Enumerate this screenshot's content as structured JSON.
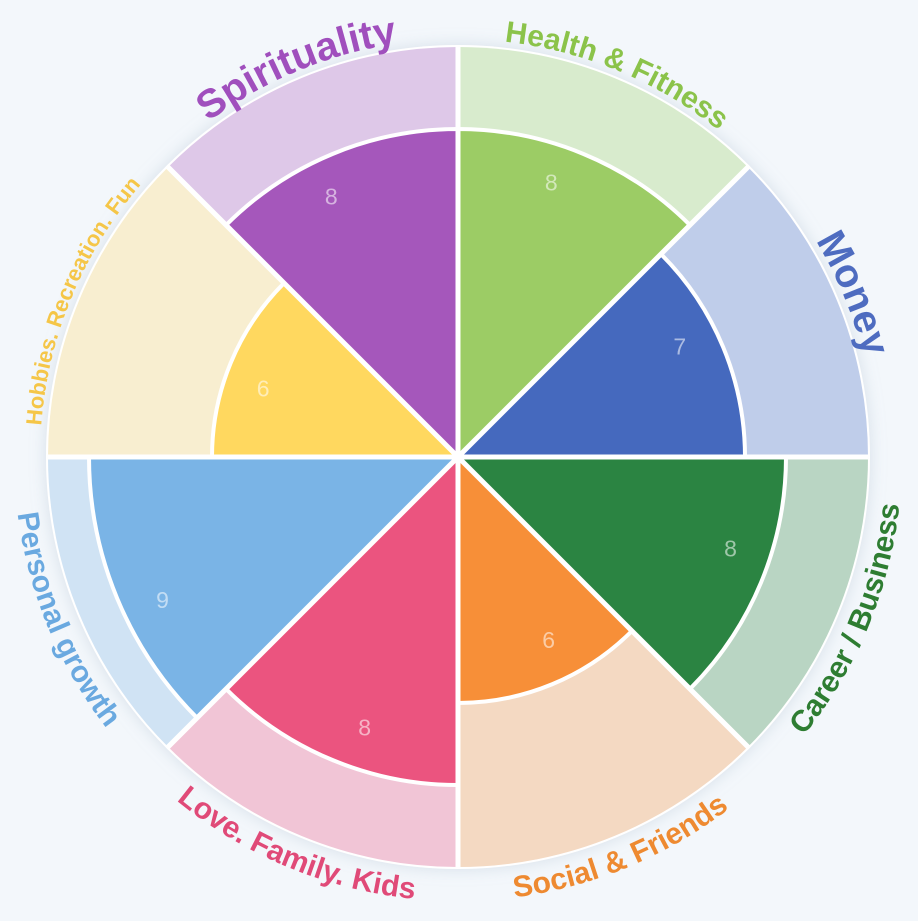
{
  "chart_data": {
    "type": "radial-bar",
    "scale_max": 10,
    "segments": [
      {
        "name": "Health & Fitness",
        "value": 8,
        "color": "#9ccc65",
        "bg_color": "#d8ebcd",
        "text_color": "#8bc34a"
      },
      {
        "name": "Money",
        "value": 7,
        "color": "#4569be",
        "bg_color": "#bfcdea",
        "text_color": "#4e6cc0"
      },
      {
        "name": "Career / Business",
        "value": 8,
        "color": "#2b8442",
        "bg_color": "#b9d5c3",
        "text_color": "#2e7d32"
      },
      {
        "name": "Social & Friends",
        "value": 6,
        "color": "#f78f38",
        "bg_color": "#f4d9c2",
        "text_color": "#ee8a31"
      },
      {
        "name": "Love. Family. Kids",
        "value": 8,
        "color": "#eb547f",
        "bg_color": "#f1c5d6",
        "text_color": "#e04a78"
      },
      {
        "name": "Personal growth",
        "value": 9,
        "color": "#7ab4e6",
        "bg_color": "#d0e3f4",
        "text_color": "#6aa9e0"
      },
      {
        "name": "Hobbies. Recreation. Fun",
        "value": 6,
        "color": "#ffd85f",
        "bg_color": "#f8eed0",
        "text_color": "#f5c648"
      },
      {
        "name": "Spirituality",
        "value": 8,
        "color": "#a557bb",
        "bg_color": "#dec8e8",
        "text_color": "#a04fbd"
      }
    ]
  }
}
